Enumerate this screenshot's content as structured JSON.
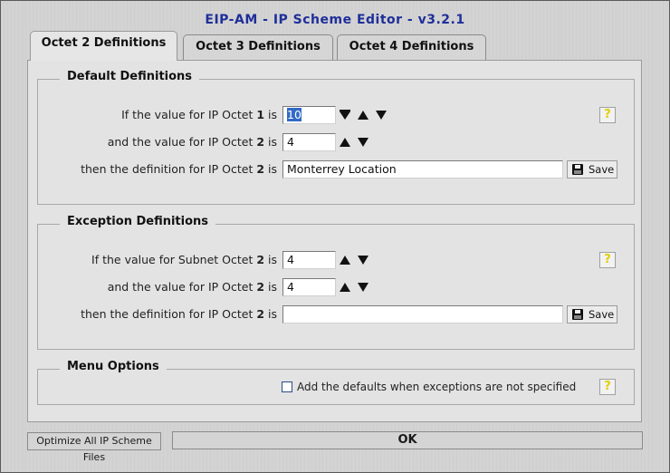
{
  "window": {
    "title": "EIP-AM - IP Scheme Editor - v3.2.1"
  },
  "tabs": [
    {
      "label": "Octet 2 Definitions",
      "active": true
    },
    {
      "label": "Octet 3 Definitions",
      "active": false
    },
    {
      "label": "Octet 4 Definitions",
      "active": false
    }
  ],
  "default_definitions": {
    "title": "Default Definitions",
    "row1": {
      "prefix": "If the value for IP Octet ",
      "num": "1",
      "suffix": " is",
      "value": "10"
    },
    "row2": {
      "prefix": "and the value for IP Octet ",
      "num": "2",
      "suffix": " is",
      "value": "4"
    },
    "row3": {
      "prefix": "then the definition for IP Octet ",
      "num": "2",
      "suffix": " is",
      "value": "Monterrey Location"
    },
    "save_label": "Save",
    "help": "?"
  },
  "exception_definitions": {
    "title": "Exception Definitions",
    "row1": {
      "prefix": "If the value for Subnet Octet ",
      "num": "2",
      "suffix": " is",
      "value": "4"
    },
    "row2": {
      "prefix": "and the value for IP Octet ",
      "num": "2",
      "suffix": " is",
      "value": "4"
    },
    "row3": {
      "prefix": "then the definition for IP Octet ",
      "num": "2",
      "suffix": " is",
      "value": ""
    },
    "save_label": "Save",
    "help": "?"
  },
  "menu_options": {
    "title": "Menu Options",
    "checkbox_label": "Add the defaults when exceptions are not specified",
    "checked": false,
    "help": "?"
  },
  "footer": {
    "optimize_label": "Optimize All IP Scheme Files",
    "ok_label": "OK"
  },
  "colors": {
    "title": "#1f2f99",
    "selection": "#316ac5",
    "help_mark": "#e0d000"
  },
  "icons": [
    "spin-up-icon",
    "spin-down-icon",
    "spin-bottom-icon",
    "save-disk-icon",
    "help-icon"
  ]
}
